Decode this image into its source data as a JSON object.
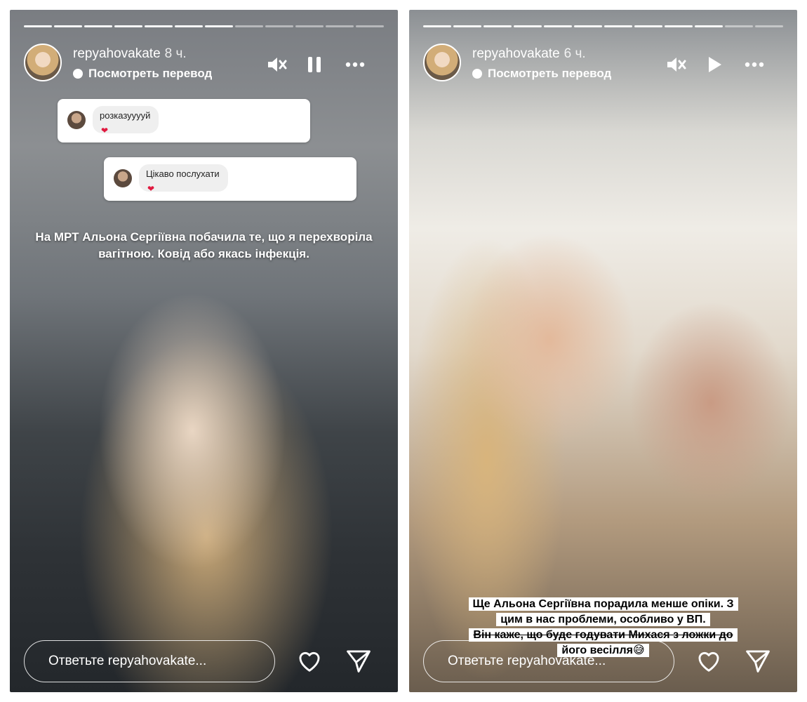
{
  "stories": [
    {
      "username": "repyahovakate",
      "time": "8 ч.",
      "translate_label": "Посмотреть перевод",
      "question_boxes": [
        {
          "text": "розказууууй",
          "reaction": "❤"
        },
        {
          "text": "Цікаво послухати",
          "reaction": "❤"
        }
      ],
      "caption": "На МРТ Альона Сергіївна побачила те, що я перехворіла вагітною. Ковід або якась інфекція.",
      "reply_placeholder": "Ответьте repyahovakate...",
      "controls": [
        "speaker-muted-icon",
        "pause-icon",
        "more-icon"
      ],
      "progress": {
        "segments": 12,
        "viewed": 7
      }
    },
    {
      "username": "repyahovakate",
      "time": "6 ч.",
      "translate_label": "Посмотреть перевод",
      "caption_lines": [
        "Ще Альона Сергіївна порадила менше опіки. З",
        "цим в нас проблеми, особливо у ВП.",
        "Він каже, що буде годувати Михася з ложки до",
        "його весілля😅"
      ],
      "reply_placeholder": "Ответьте repyahovakate...",
      "controls": [
        "speaker-muted-icon",
        "play-icon",
        "more-icon"
      ],
      "progress": {
        "segments": 12,
        "viewed": 10
      }
    }
  ],
  "colors": {
    "heart": "#e0193f",
    "text": "#ffffff"
  }
}
